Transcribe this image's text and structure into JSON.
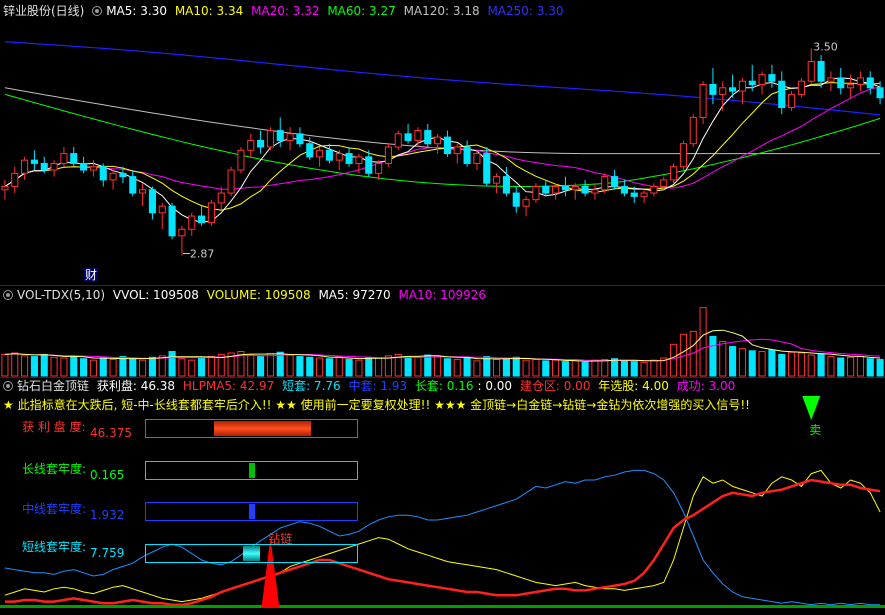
{
  "price_pane": {
    "stock_name": "锌业股份(日线)",
    "ma5": "MA5: 3.30",
    "ma10": "MA10: 3.34",
    "ma20": "MA20: 3.32",
    "ma60": "MA60: 3.27",
    "ma120": "MA120: 3.18",
    "ma250": "MA250: 3.30",
    "high_label": "3.50",
    "low_label": "2.87",
    "finance_mark": "财",
    "colors": {
      "ma5": "#ffffff",
      "ma10": "#ffff00",
      "ma20": "#ff00ff",
      "ma60": "#00ff00",
      "ma120": "#c0c0c0",
      "ma250": "#2020ff",
      "up": "#ff3030",
      "down": "#00e5ff"
    }
  },
  "volume_pane": {
    "title": "VOL-TDX(5,10)",
    "vvol": "VVOL: 109508",
    "volume": "VOLUME: 109508",
    "ma5": "MA5: 97270",
    "ma10": "MA10: 109926"
  },
  "indicator_pane": {
    "title": "钻石白金顶链",
    "profit": "获利盘: 46.38",
    "hlpma5": "HLPMA5: 42.97",
    "short": "短套: 7.76",
    "mid": "中套: 1.93",
    "long": "长套: 0.16",
    "long_extra": ": 0.00",
    "build": "建仓区: 0.00",
    "year_pick": "年选股: 4.00",
    "success": "成功: 3.00",
    "notice": "★ 此指标意在大跌后, 短-中-长线套都套牢后介入!! ★★ 使用前一定要复权处理!! ★★★ 金顶链→白金链→钻链→金钻为依次增强的买入信号!!",
    "sell_mark": "卖",
    "chain_mark": "钻链",
    "gauges": [
      {
        "label": "获 利 盘 度:",
        "value": "46.375",
        "level": 0.46
      },
      {
        "label": "长线套牢度:",
        "value": "0.165",
        "level": 0.02
      },
      {
        "label": "中线套牢度:",
        "value": "1.932",
        "level": 0.02
      },
      {
        "label": "短线套牢度:",
        "value": "7.759",
        "level": 0.08
      }
    ]
  },
  "candles": [
    [
      3.07,
      3.1,
      3.04,
      3.08
    ],
    [
      3.08,
      3.14,
      3.06,
      3.12
    ],
    [
      3.12,
      3.17,
      3.1,
      3.16
    ],
    [
      3.16,
      3.19,
      3.13,
      3.15
    ],
    [
      3.15,
      3.17,
      3.12,
      3.13
    ],
    [
      3.13,
      3.16,
      3.11,
      3.15
    ],
    [
      3.15,
      3.2,
      3.14,
      3.18
    ],
    [
      3.18,
      3.2,
      3.14,
      3.15
    ],
    [
      3.15,
      3.17,
      3.12,
      3.13
    ],
    [
      3.13,
      3.16,
      3.11,
      3.14
    ],
    [
      3.14,
      3.15,
      3.08,
      3.1
    ],
    [
      3.1,
      3.13,
      3.07,
      3.12
    ],
    [
      3.12,
      3.14,
      3.09,
      3.11
    ],
    [
      3.11,
      3.13,
      3.05,
      3.06
    ],
    [
      3.06,
      3.09,
      3.02,
      3.07
    ],
    [
      3.07,
      3.08,
      2.98,
      3.0
    ],
    [
      3.0,
      3.03,
      2.95,
      3.02
    ],
    [
      3.02,
      3.03,
      2.92,
      2.93
    ],
    [
      2.93,
      2.96,
      2.87,
      2.95
    ],
    [
      2.95,
      3.0,
      2.93,
      2.99
    ],
    [
      2.99,
      3.02,
      2.96,
      2.97
    ],
    [
      2.97,
      3.04,
      2.96,
      3.03
    ],
    [
      3.03,
      3.08,
      3.01,
      3.06
    ],
    [
      3.06,
      3.14,
      3.05,
      3.13
    ],
    [
      3.13,
      3.2,
      3.12,
      3.19
    ],
    [
      3.19,
      3.24,
      3.17,
      3.22
    ],
    [
      3.22,
      3.25,
      3.18,
      3.2
    ],
    [
      3.2,
      3.26,
      3.19,
      3.25
    ],
    [
      3.25,
      3.29,
      3.2,
      3.22
    ],
    [
      3.22,
      3.26,
      3.19,
      3.24
    ],
    [
      3.24,
      3.26,
      3.2,
      3.21
    ],
    [
      3.21,
      3.23,
      3.16,
      3.17
    ],
    [
      3.17,
      3.2,
      3.14,
      3.19
    ],
    [
      3.19,
      3.21,
      3.15,
      3.16
    ],
    [
      3.16,
      3.19,
      3.13,
      3.18
    ],
    [
      3.18,
      3.2,
      3.14,
      3.15
    ],
    [
      3.15,
      3.18,
      3.12,
      3.17
    ],
    [
      3.17,
      3.19,
      3.11,
      3.12
    ],
    [
      3.12,
      3.16,
      3.1,
      3.15
    ],
    [
      3.15,
      3.21,
      3.14,
      3.2
    ],
    [
      3.2,
      3.25,
      3.19,
      3.24
    ],
    [
      3.24,
      3.27,
      3.21,
      3.22
    ],
    [
      3.22,
      3.26,
      3.2,
      3.25
    ],
    [
      3.25,
      3.27,
      3.2,
      3.21
    ],
    [
      3.21,
      3.24,
      3.18,
      3.23
    ],
    [
      3.23,
      3.25,
      3.17,
      3.18
    ],
    [
      3.18,
      3.21,
      3.15,
      3.2
    ],
    [
      3.2,
      3.22,
      3.14,
      3.15
    ],
    [
      3.15,
      3.19,
      3.13,
      3.18
    ],
    [
      3.18,
      3.2,
      3.08,
      3.09
    ],
    [
      3.09,
      3.12,
      3.06,
      3.11
    ],
    [
      3.11,
      3.14,
      3.05,
      3.06
    ],
    [
      3.06,
      3.08,
      3.0,
      3.02
    ],
    [
      3.02,
      3.05,
      2.99,
      3.04
    ],
    [
      3.04,
      3.09,
      3.03,
      3.08
    ],
    [
      3.08,
      3.1,
      3.05,
      3.06
    ],
    [
      3.06,
      3.09,
      3.04,
      3.08
    ],
    [
      3.08,
      3.11,
      3.05,
      3.07
    ],
    [
      3.07,
      3.09,
      3.04,
      3.08
    ],
    [
      3.08,
      3.1,
      3.05,
      3.06
    ],
    [
      3.06,
      3.09,
      3.04,
      3.07
    ],
    [
      3.07,
      3.12,
      3.06,
      3.11
    ],
    [
      3.11,
      3.13,
      3.07,
      3.08
    ],
    [
      3.08,
      3.1,
      3.05,
      3.06
    ],
    [
      3.06,
      3.08,
      3.03,
      3.05
    ],
    [
      3.05,
      3.07,
      3.03,
      3.06
    ],
    [
      3.06,
      3.09,
      3.05,
      3.08
    ],
    [
      3.08,
      3.11,
      3.07,
      3.1
    ],
    [
      3.1,
      3.15,
      3.09,
      3.14
    ],
    [
      3.14,
      3.22,
      3.13,
      3.21
    ],
    [
      3.21,
      3.3,
      3.2,
      3.29
    ],
    [
      3.29,
      3.4,
      3.27,
      3.39
    ],
    [
      3.39,
      3.44,
      3.33,
      3.36
    ],
    [
      3.36,
      3.4,
      3.31,
      3.38
    ],
    [
      3.38,
      3.42,
      3.35,
      3.37
    ],
    [
      3.37,
      3.41,
      3.33,
      3.4
    ],
    [
      3.4,
      3.45,
      3.37,
      3.39
    ],
    [
      3.39,
      3.43,
      3.36,
      3.42
    ],
    [
      3.42,
      3.45,
      3.38,
      3.4
    ],
    [
      3.4,
      3.43,
      3.3,
      3.32
    ],
    [
      3.32,
      3.37,
      3.31,
      3.36
    ],
    [
      3.36,
      3.41,
      3.35,
      3.4
    ],
    [
      3.4,
      3.5,
      3.39,
      3.46
    ],
    [
      3.46,
      3.48,
      3.38,
      3.4
    ],
    [
      3.4,
      3.43,
      3.37,
      3.41
    ],
    [
      3.41,
      3.44,
      3.36,
      3.38
    ],
    [
      3.38,
      3.42,
      3.35,
      3.39
    ],
    [
      3.39,
      3.43,
      3.37,
      3.41
    ],
    [
      3.41,
      3.43,
      3.36,
      3.38
    ],
    [
      3.38,
      3.4,
      3.33,
      3.35
    ]
  ],
  "volumes": [
    30,
    32,
    28,
    27,
    30,
    26,
    25,
    28,
    24,
    22,
    25,
    23,
    27,
    24,
    22,
    26,
    28,
    34,
    24,
    22,
    25,
    27,
    30,
    32,
    34,
    29,
    27,
    31,
    33,
    29,
    27,
    26,
    25,
    24,
    27,
    23,
    22,
    26,
    25,
    28,
    30,
    27,
    26,
    29,
    28,
    24,
    23,
    25,
    21,
    27,
    23,
    24,
    26,
    22,
    23,
    21,
    22,
    20,
    21,
    19,
    22,
    23,
    24,
    21,
    20,
    19,
    22,
    25,
    44,
    58,
    62,
    95,
    55,
    48,
    41,
    38,
    35,
    34,
    36,
    30,
    33,
    32,
    29,
    31,
    27,
    25,
    26,
    27,
    24,
    23
  ],
  "indicator_series": {
    "blue": [
      25,
      24,
      23,
      22,
      22,
      21,
      23,
      24,
      22,
      20,
      21,
      24,
      26,
      28,
      32,
      35,
      38,
      40,
      38,
      34,
      30,
      28,
      27,
      29,
      33,
      38,
      42,
      46,
      50,
      52,
      54,
      53,
      51,
      48,
      45,
      46,
      48,
      52,
      55,
      57,
      58,
      58,
      57,
      55,
      55,
      56,
      57,
      58,
      60,
      62,
      64,
      66,
      68,
      72,
      76,
      75,
      77,
      79,
      78,
      80,
      80,
      82,
      83,
      85,
      86,
      86,
      84,
      80,
      72,
      60,
      45,
      30,
      22,
      15,
      10,
      7,
      6,
      5,
      4,
      3,
      4,
      3,
      2,
      3,
      2,
      3,
      2,
      3,
      2,
      2
    ],
    "yellow": [
      8,
      10,
      12,
      11,
      10,
      12,
      13,
      12,
      10,
      9,
      11,
      13,
      14,
      12,
      10,
      8,
      6,
      5,
      4,
      5,
      6,
      8,
      10,
      12,
      14,
      16,
      18,
      20,
      22,
      26,
      28,
      30,
      32,
      34,
      36,
      38,
      40,
      42,
      44,
      43,
      40,
      37,
      35,
      33,
      31,
      29,
      28,
      27,
      26,
      25,
      24,
      22,
      20,
      18,
      16,
      15,
      14,
      15,
      16,
      14,
      13,
      12,
      12,
      11,
      12,
      13,
      14,
      16,
      30,
      50,
      70,
      82,
      78,
      80,
      76,
      74,
      72,
      70,
      78,
      82,
      80,
      76,
      84,
      86,
      78,
      75,
      80,
      78,
      72,
      60
    ],
    "red": [
      4,
      4,
      5,
      5,
      4,
      4,
      5,
      6,
      5,
      4,
      3,
      3,
      4,
      5,
      4,
      3,
      3,
      2,
      2,
      3,
      5,
      7,
      10,
      12,
      14,
      16,
      18,
      20,
      22,
      24,
      26,
      28,
      30,
      30,
      28,
      26,
      24,
      22,
      20,
      18,
      17,
      16,
      15,
      14,
      13,
      12,
      11,
      10,
      10,
      9,
      8,
      8,
      8,
      9,
      10,
      11,
      12,
      12,
      11,
      11,
      12,
      13,
      14,
      15,
      17,
      22,
      30,
      40,
      50,
      55,
      58,
      62,
      66,
      70,
      72,
      71,
      70,
      72,
      73,
      74,
      76,
      78,
      80,
      79,
      78,
      77,
      77,
      75,
      74,
      73
    ],
    "spike_index": 27,
    "sell_index": 82
  }
}
